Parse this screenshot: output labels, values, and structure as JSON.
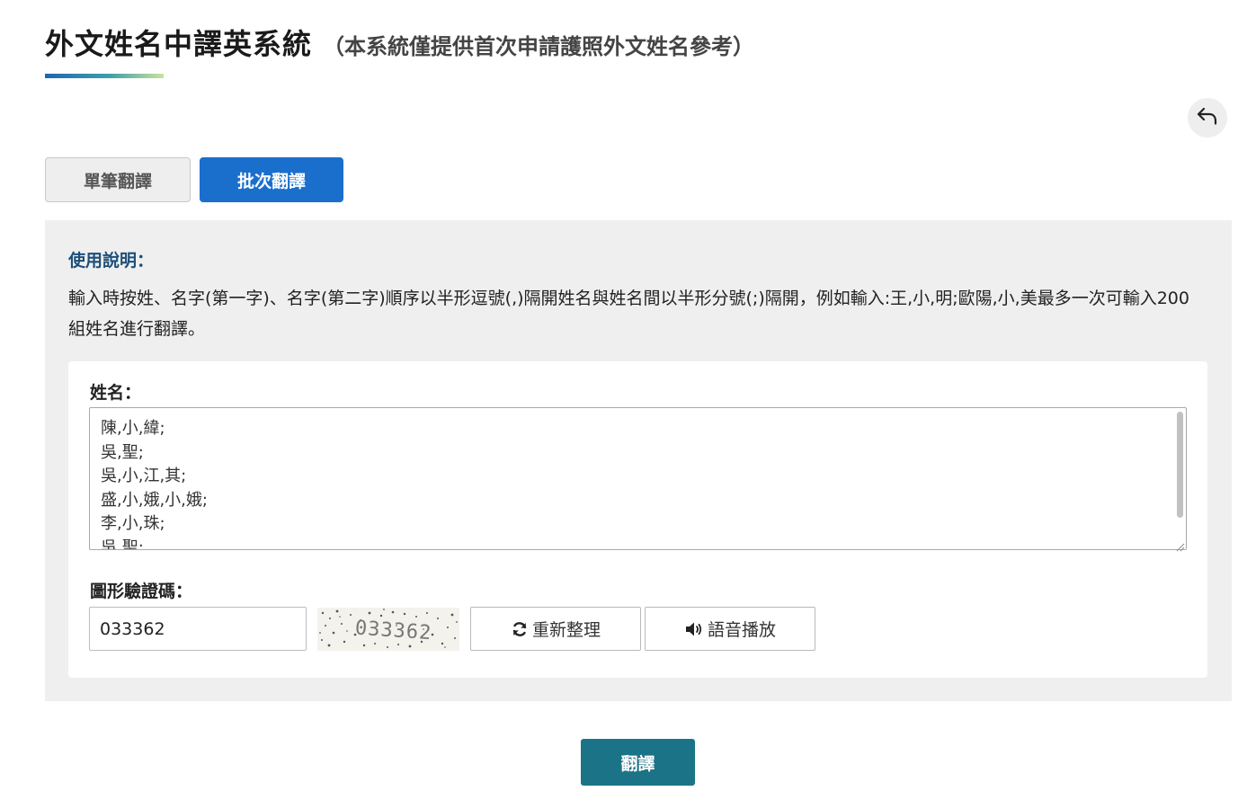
{
  "header": {
    "title": "外文姓名中譯英系統",
    "subtitle": "（本系統僅提供首次申請護照外文姓名參考）"
  },
  "nav": {
    "back_icon": "undo-arrow-icon"
  },
  "tabs": [
    {
      "label": "單筆翻譯",
      "active": false
    },
    {
      "label": "批次翻譯",
      "active": true
    }
  ],
  "instructions": {
    "title": "使用說明：",
    "text": "輸入時按姓、名字(第一字)、名字(第二字)順序以半形逗號(,)隔開姓名與姓名間以半形分號(;)隔開，例如輸入:王,小,明;歐陽,小,美最多一次可輸入200組姓名進行翻譯。"
  },
  "form": {
    "names_label": "姓名：",
    "names_value": "陳,小,緯;\n吳,聖;\n吳,小,江,其;\n盛,小,娥,小,娥;\n李,小,珠;\n吳,聖;",
    "captcha_label": "圖形驗證碼：",
    "captcha_value": "033362",
    "captcha_image_text": "033362",
    "refresh_label": "重新整理",
    "refresh_icon": "refresh-icon",
    "audio_label": "語音播放",
    "audio_icon": "speaker-icon"
  },
  "submit": {
    "label": "翻譯"
  },
  "colors": {
    "primary_blue": "#1a6fcd",
    "submit_teal": "#1b7387",
    "instructions_title": "#1d4f7a",
    "panel_bg": "#efefef"
  }
}
